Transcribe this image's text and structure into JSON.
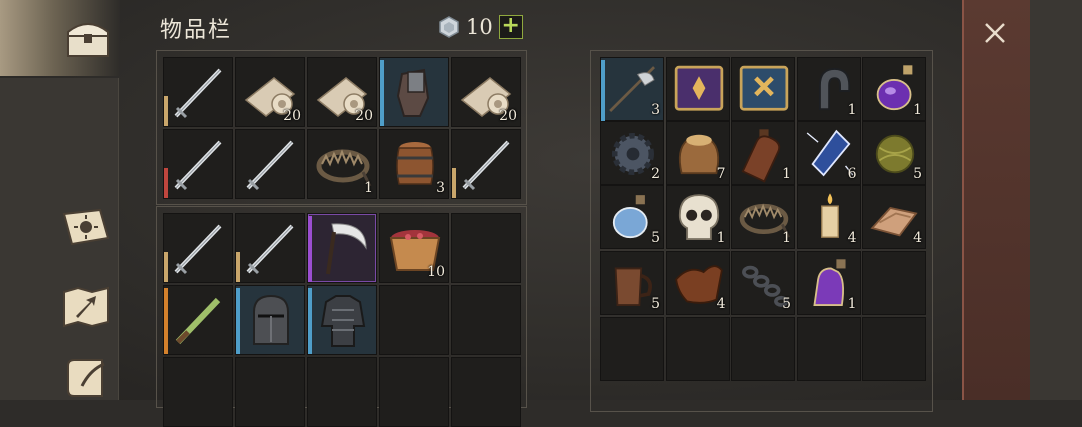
{
  "header": {
    "title": "物品栏",
    "currency_icon": "silver-coin-icon",
    "currency_amount": "10",
    "add_label": "+"
  },
  "tabs": [
    {
      "name": "chest-tab",
      "icon": "chest-icon"
    },
    {
      "name": "sun-book-tab",
      "icon": "sun-book-icon"
    },
    {
      "name": "map-tab",
      "icon": "map-arrow-icon"
    },
    {
      "name": "scroll-tab",
      "icon": "scroll-feather-icon"
    }
  ],
  "colors": {
    "bar_tan": "#c9a66b",
    "bar_red": "#c0463e",
    "bar_blue": "#4f9ec9",
    "bar_purple": "#9b4ed1",
    "bar_orange": "#d4812c"
  },
  "equipment": {
    "top_rows": [
      [
        {
          "icon": "longsword-icon",
          "count": "",
          "bar": "tan"
        },
        {
          "icon": "cloth-roll-icon",
          "count": "20",
          "bar": ""
        },
        {
          "icon": "cloth-roll-icon",
          "count": "20",
          "bar": ""
        },
        {
          "icon": "iron-gauntlet-icon",
          "count": "",
          "bar": "blue"
        },
        {
          "icon": "cloth-roll-icon",
          "count": "20",
          "bar": ""
        }
      ],
      [
        {
          "icon": "longsword-icon",
          "count": "",
          "bar": "red"
        },
        {
          "icon": "longsword-icon",
          "count": "",
          "bar": ""
        },
        {
          "icon": "bear-trap-icon",
          "count": "1",
          "bar": ""
        },
        {
          "icon": "barrel-icon",
          "count": "3",
          "bar": ""
        },
        {
          "icon": "longsword-icon",
          "count": "",
          "bar": "tan"
        }
      ]
    ],
    "bottom_rows": [
      [
        {
          "icon": "longsword-icon",
          "count": "",
          "bar": "tan"
        },
        {
          "icon": "longsword-icon",
          "count": "",
          "bar": "tan"
        },
        {
          "icon": "scythe-icon",
          "count": "",
          "bar": "purple"
        },
        {
          "icon": "berry-bucket-icon",
          "count": "10",
          "bar": ""
        },
        {
          "icon": "",
          "count": "",
          "bar": ""
        }
      ],
      [
        {
          "icon": "green-dagger-icon",
          "count": "",
          "bar": "orange"
        },
        {
          "icon": "great-helm-icon",
          "count": "",
          "bar": "blue"
        },
        {
          "icon": "chainmail-icon",
          "count": "",
          "bar": "blue"
        },
        {
          "icon": "",
          "count": "",
          "bar": ""
        },
        {
          "icon": "",
          "count": "",
          "bar": ""
        }
      ]
    ]
  },
  "backpack": {
    "rows": [
      [
        {
          "icon": "halberd-icon",
          "count": "3",
          "sub_icon": "arrow-icon",
          "bar": "blue"
        },
        {
          "icon": "purple-tome-icon",
          "count": "",
          "bar": ""
        },
        {
          "icon": "blue-tome-icon",
          "count": "",
          "bar": ""
        },
        {
          "icon": "horseshoe-magnet-icon",
          "count": "1",
          "bar": ""
        },
        {
          "icon": "purple-potion-icon",
          "count": "1",
          "bar": ""
        }
      ],
      [
        {
          "icon": "cogwheel-icon",
          "count": "2",
          "bar": ""
        },
        {
          "icon": "grain-sack-icon",
          "count": "7",
          "bar": ""
        },
        {
          "icon": "leather-flask-icon",
          "count": "1",
          "bar": ""
        },
        {
          "icon": "crystal-shard-icon",
          "count": "6",
          "bar": ""
        },
        {
          "icon": "yarn-ball-icon",
          "count": "5",
          "bar": ""
        }
      ],
      [
        {
          "icon": "water-flask-icon",
          "count": "5",
          "bar": ""
        },
        {
          "icon": "skull-icon",
          "count": "1",
          "bar": ""
        },
        {
          "icon": "bear-trap-icon",
          "count": "1",
          "bar": ""
        },
        {
          "icon": "candle-icon",
          "count": "4",
          "bar": ""
        },
        {
          "icon": "folded-cloth-icon",
          "count": "4",
          "bar": ""
        }
      ],
      [
        {
          "icon": "wooden-mug-icon",
          "count": "5",
          "bar": ""
        },
        {
          "icon": "leather-scrap-icon",
          "count": "4",
          "bar": ""
        },
        {
          "icon": "iron-chain-icon",
          "count": "5",
          "bar": ""
        },
        {
          "icon": "violet-potion-icon",
          "count": "1",
          "bar": ""
        },
        {
          "icon": "",
          "count": "",
          "bar": ""
        }
      ],
      [
        {
          "icon": "",
          "count": "",
          "bar": ""
        },
        {
          "icon": "",
          "count": "",
          "bar": ""
        },
        {
          "icon": "",
          "count": "",
          "bar": ""
        },
        {
          "icon": "",
          "count": "",
          "bar": ""
        },
        {
          "icon": "",
          "count": "",
          "bar": ""
        }
      ]
    ]
  },
  "close": {
    "icon": "close-icon"
  }
}
